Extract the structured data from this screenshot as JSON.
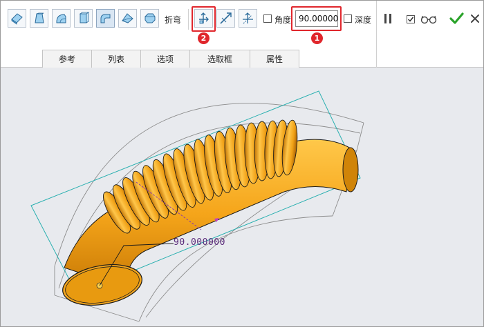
{
  "toolbar": {
    "bend_label": "折弯",
    "angle_label": "角度",
    "angle_value": "90.00000",
    "depth_label": "深度",
    "callout_1": "1",
    "callout_2": "2"
  },
  "tabs": [
    {
      "label": "参考"
    },
    {
      "label": "列表"
    },
    {
      "label": "选项"
    },
    {
      "label": "选取框"
    },
    {
      "label": "属性"
    }
  ],
  "viewport": {
    "dimension_label": "90.000000"
  },
  "colors": {
    "accent": "#e0262c",
    "confirm": "#2aa32a",
    "tube": "#f5a51a",
    "frame_line": "#2ab0b0"
  },
  "icons": {
    "pause": "pause-icon",
    "preview": "glasses-icon",
    "confirm": "checkmark-icon",
    "cancel": "close-icon"
  }
}
